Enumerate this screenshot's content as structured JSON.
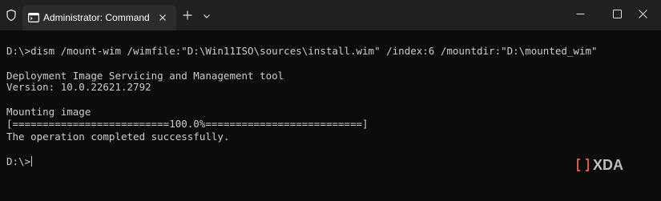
{
  "window": {
    "tab_title": "Administrator: Command Pro",
    "icons": {
      "app": "shield-icon",
      "tab": "terminal-icon",
      "tab_close": "close-icon",
      "new_tab": "plus-icon",
      "dropdown": "chevron-down-icon",
      "minimize": "minimize-icon",
      "maximize": "maximize-icon",
      "close": "close-icon"
    }
  },
  "terminal": {
    "command_line": "D:\\>dism /mount-wim /wimfile:\"D:\\Win11ISO\\sources\\install.wim\" /index:6 /mountdir:\"D:\\mounted_wim\"",
    "tool_name": "Deployment Image Servicing and Management tool",
    "version": "Version: 10.0.22621.2792",
    "status": "Mounting image",
    "progress_line": "[==========================100.0%==========================]",
    "progress_fraction": 1.0,
    "result": "The operation completed successfully.",
    "prompt": "D:\\>"
  },
  "watermark": {
    "text": "XDA",
    "brand_color": "#d9534f"
  },
  "colors": {
    "background": "#0c0c0c",
    "titlebar": "#202020",
    "active_tab": "#2c2c2c",
    "text": "#cccccc"
  }
}
